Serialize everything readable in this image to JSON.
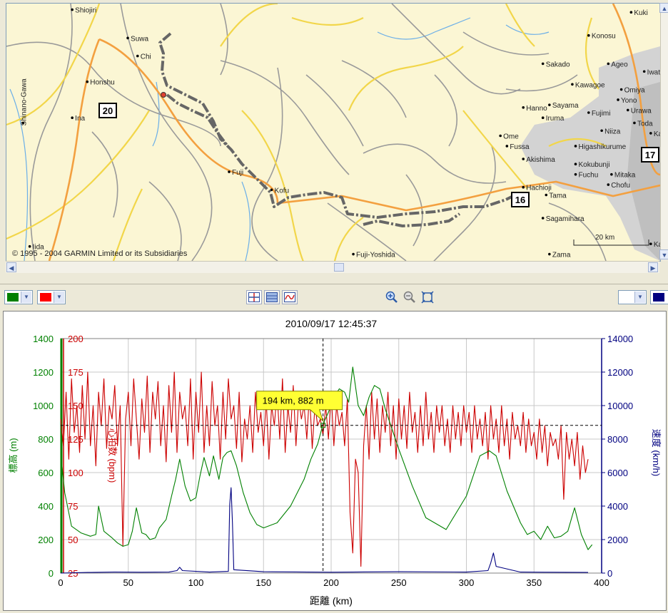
{
  "map": {
    "copyright": "© 1995 - 2004 GARMIN Limited or its Subsidiaries",
    "scale_label": "20 km",
    "places": [
      {
        "name": "Shiojiri",
        "lx": 0.105,
        "ly": 0.01
      },
      {
        "name": "Suwa",
        "lx": 0.19,
        "ly": 0.12
      },
      {
        "name": "Chi",
        "lx": 0.205,
        "ly": 0.19
      },
      {
        "name": "Honshu",
        "lx": 0.128,
        "ly": 0.29
      },
      {
        "name": "Ina",
        "lx": 0.105,
        "ly": 0.43
      },
      {
        "name": "Shinano-Gawa",
        "lx": 0.03,
        "ly": 0.45
      },
      {
        "name": "Iida",
        "lx": 0.04,
        "ly": 0.93
      },
      {
        "name": "Fuji",
        "lx": 0.345,
        "ly": 0.64
      },
      {
        "name": "Kofu",
        "lx": 0.41,
        "ly": 0.71
      },
      {
        "name": "Fuji-Yoshida",
        "lx": 0.535,
        "ly": 0.96
      },
      {
        "name": "Hachioji",
        "lx": 0.795,
        "ly": 0.7
      },
      {
        "name": "Tama",
        "lx": 0.83,
        "ly": 0.73
      },
      {
        "name": "Sagamihara",
        "lx": 0.825,
        "ly": 0.82
      },
      {
        "name": "Zama",
        "lx": 0.835,
        "ly": 0.96
      },
      {
        "name": "Fuchu",
        "lx": 0.875,
        "ly": 0.65
      },
      {
        "name": "Chofu",
        "lx": 0.925,
        "ly": 0.69
      },
      {
        "name": "Mitaka",
        "lx": 0.93,
        "ly": 0.65
      },
      {
        "name": "Kokubunji",
        "lx": 0.875,
        "ly": 0.61
      },
      {
        "name": "Akishima",
        "lx": 0.795,
        "ly": 0.59
      },
      {
        "name": "Fussa",
        "lx": 0.77,
        "ly": 0.54
      },
      {
        "name": "Ome",
        "lx": 0.76,
        "ly": 0.5
      },
      {
        "name": "Higashikurume",
        "lx": 0.875,
        "ly": 0.54
      },
      {
        "name": "Niiza",
        "lx": 0.915,
        "ly": 0.48
      },
      {
        "name": "Iruma",
        "lx": 0.825,
        "ly": 0.43
      },
      {
        "name": "Hanno",
        "lx": 0.795,
        "ly": 0.39
      },
      {
        "name": "Sayama",
        "lx": 0.835,
        "ly": 0.38
      },
      {
        "name": "Fujimi",
        "lx": 0.895,
        "ly": 0.41
      },
      {
        "name": "Urawa",
        "lx": 0.955,
        "ly": 0.4
      },
      {
        "name": "Toda",
        "lx": 0.965,
        "ly": 0.45
      },
      {
        "name": "Kawagoe",
        "lx": 0.87,
        "ly": 0.3
      },
      {
        "name": "Sakado",
        "lx": 0.825,
        "ly": 0.22
      },
      {
        "name": "Omiya",
        "lx": 0.945,
        "ly": 0.32
      },
      {
        "name": "Yono",
        "lx": 0.94,
        "ly": 0.36
      },
      {
        "name": "Ageo",
        "lx": 0.925,
        "ly": 0.22
      },
      {
        "name": "Konosu",
        "lx": 0.895,
        "ly": 0.11
      },
      {
        "name": "Kuki",
        "lx": 0.96,
        "ly": 0.02
      },
      {
        "name": "Iwats",
        "lx": 0.98,
        "ly": 0.25
      },
      {
        "name": "Ka",
        "lx": 0.99,
        "ly": 0.49
      },
      {
        "name": "Kav",
        "lx": 0.99,
        "ly": 0.92
      }
    ],
    "route_shields": [
      "20",
      "16",
      "17"
    ]
  },
  "toolbar": {
    "left_color_1": "#008000",
    "left_color_2": "#ff0000",
    "right_color_1": "#ffffff",
    "right_color_2": "#000080",
    "x_axis_select": "距離",
    "icons": [
      "crosshair-icon",
      "split-view-icon",
      "graph-icon",
      "zoom-in-icon",
      "zoom-out-icon",
      "zoom-fit-icon"
    ]
  },
  "chart_data": {
    "type": "line",
    "title": "2010/09/17 12:45:37",
    "xlabel": "距離 (km)",
    "xlim": [
      0,
      400
    ],
    "x_ticks": [
      0,
      50,
      100,
      150,
      200,
      250,
      300,
      350,
      400
    ],
    "axes": {
      "elevation": {
        "label": "標高 (m)",
        "ylim": [
          0,
          1400
        ],
        "ticks": [
          0,
          200,
          400,
          600,
          800,
          1000,
          1200,
          1400
        ],
        "color": "#008000"
      },
      "heart_rate": {
        "label": "心拍数 (bpm)",
        "ylim": [
          25,
          200
        ],
        "ticks": [
          25,
          50,
          75,
          100,
          125,
          150,
          175,
          200
        ],
        "color": "#cc0000"
      },
      "speed": {
        "label": "速度 (km/h)",
        "ylim": [
          0,
          14000
        ],
        "ticks": [
          0,
          2000,
          4000,
          6000,
          8000,
          10000,
          12000,
          14000
        ],
        "color": "#000080"
      }
    },
    "cursor": {
      "x": 194,
      "y": 882,
      "label": "194 km, 882 m"
    },
    "grid": true,
    "series": [
      {
        "name": "標高 (m)",
        "axis": "elevation",
        "color": "#008000",
        "x": [
          0,
          3,
          8,
          15,
          22,
          26,
          28,
          32,
          38,
          42,
          46,
          50,
          53,
          56,
          60,
          63,
          66,
          70,
          73,
          78,
          82,
          85,
          88,
          92,
          96,
          100,
          103,
          106,
          110,
          113,
          117,
          120,
          123,
          126,
          130,
          135,
          140,
          145,
          150,
          160,
          170,
          180,
          185,
          190,
          194,
          198,
          202,
          206,
          210,
          213,
          216,
          220,
          224,
          228,
          232,
          236,
          240,
          250,
          260,
          270,
          285,
          300,
          310,
          317,
          322,
          330,
          340,
          345,
          350,
          355,
          360,
          365,
          370,
          375,
          380,
          385,
          390,
          393
        ],
        "y": [
          720,
          480,
          280,
          240,
          220,
          230,
          400,
          250,
          210,
          180,
          160,
          170,
          250,
          390,
          240,
          230,
          200,
          210,
          270,
          320,
          460,
          560,
          680,
          520,
          430,
          450,
          580,
          690,
          580,
          700,
          560,
          690,
          720,
          730,
          640,
          480,
          360,
          290,
          270,
          300,
          400,
          560,
          680,
          770,
          890,
          960,
          1050,
          1100,
          1080,
          1020,
          1230,
          1000,
          940,
          1050,
          1120,
          1100,
          980,
          740,
          520,
          330,
          260,
          460,
          700,
          730,
          700,
          490,
          300,
          230,
          250,
          200,
          280,
          210,
          220,
          250,
          390,
          230,
          140,
          170
        ]
      },
      {
        "name": "心拍数 (bpm)",
        "axis": "heart_rate",
        "color": "#cc0000",
        "x": [
          0,
          2,
          4,
          6,
          8,
          10,
          12,
          14,
          16,
          18,
          20,
          22,
          24,
          26,
          28,
          30,
          32,
          34,
          36,
          38,
          40,
          42,
          44,
          46,
          48,
          50,
          52,
          54,
          56,
          58,
          60,
          62,
          64,
          66,
          68,
          70,
          72,
          74,
          76,
          78,
          80,
          82,
          84,
          86,
          88,
          90,
          92,
          94,
          96,
          98,
          100,
          102,
          104,
          106,
          108,
          110,
          112,
          114,
          116,
          118,
          120,
          122,
          124,
          126,
          128,
          130,
          132,
          134,
          136,
          138,
          140,
          142,
          144,
          146,
          148,
          150,
          152,
          154,
          156,
          158,
          160,
          162,
          164,
          166,
          168,
          170,
          172,
          174,
          176,
          178,
          180,
          182,
          184,
          186,
          188,
          190,
          192,
          194,
          196,
          198,
          200,
          202,
          204,
          206,
          208,
          210,
          212,
          214,
          216,
          218,
          220,
          222,
          224,
          226,
          228,
          230,
          232,
          234,
          236,
          238,
          240,
          242,
          244,
          246,
          248,
          250,
          252,
          254,
          256,
          258,
          260,
          262,
          264,
          266,
          268,
          270,
          272,
          274,
          276,
          278,
          280,
          282,
          284,
          286,
          288,
          290,
          292,
          294,
          296,
          298,
          300,
          302,
          304,
          306,
          308,
          310,
          312,
          314,
          316,
          318,
          320,
          322,
          324,
          326,
          328,
          330,
          332,
          334,
          336,
          338,
          340,
          342,
          344,
          346,
          348,
          350,
          352,
          354,
          356,
          358,
          360,
          362,
          364,
          366,
          368,
          370,
          372,
          374,
          376,
          378,
          380,
          382,
          384,
          386,
          388,
          390
        ],
        "y": [
          140,
          120,
          160,
          110,
          170,
          130,
          150,
          115,
          165,
          125,
          175,
          120,
          150,
          105,
          160,
          135,
          170,
          118,
          150,
          140,
          165,
          120,
          150,
          45,
          140,
          160,
          120,
          170,
          140,
          110,
          155,
          130,
          172,
          115,
          160,
          140,
          168,
          120,
          150,
          108,
          165,
          130,
          175,
          115,
          160,
          140,
          150,
          120,
          170,
          110,
          160,
          130,
          175,
          115,
          150,
          120,
          168,
          135,
          150,
          110,
          160,
          125,
          170,
          140,
          150,
          118,
          160,
          108,
          140,
          125,
          150,
          115,
          160,
          130,
          145,
          120,
          155,
          110,
          150,
          135,
          160,
          125,
          170,
          115,
          150,
          130,
          165,
          120,
          155,
          140,
          150,
          125,
          160,
          118,
          150,
          135,
          140,
          128,
          150,
          125,
          160,
          120,
          150,
          135,
          145,
          120,
          155,
          70,
          40,
          110,
          100,
          30,
          120,
          150,
          110,
          160,
          125,
          155,
          115,
          150,
          130,
          160,
          120,
          150,
          110,
          155,
          125,
          150,
          118,
          160,
          130,
          145,
          115,
          150,
          120,
          160,
          125,
          145,
          115,
          150,
          130,
          150,
          120,
          140,
          115,
          150,
          125,
          145,
          120,
          150,
          130,
          145,
          115,
          150,
          125,
          140,
          120,
          145,
          110,
          150,
          125,
          140,
          115,
          150,
          120,
          140,
          110,
          145,
          125,
          135,
          120,
          145,
          115,
          140,
          120,
          130,
          110,
          140,
          115,
          135,
          105,
          130,
          120,
          125,
          110,
          135,
          80,
          130,
          110,
          125,
          105,
          130,
          95,
          120,
          100,
          110
        ]
      },
      {
        "name": "速度 (km/h)",
        "axis": "speed",
        "color": "#000080",
        "x": [
          0,
          20,
          40,
          60,
          80,
          86,
          88,
          90,
          110,
          124,
          125,
          126,
          127,
          128,
          150,
          200,
          250,
          300,
          316,
          318,
          320,
          322,
          340,
          360,
          390
        ],
        "y": [
          0,
          40,
          60,
          50,
          60,
          150,
          350,
          150,
          60,
          100,
          4100,
          5100,
          3000,
          200,
          80,
          50,
          80,
          60,
          150,
          600,
          1200,
          400,
          60,
          50,
          40
        ]
      }
    ]
  }
}
